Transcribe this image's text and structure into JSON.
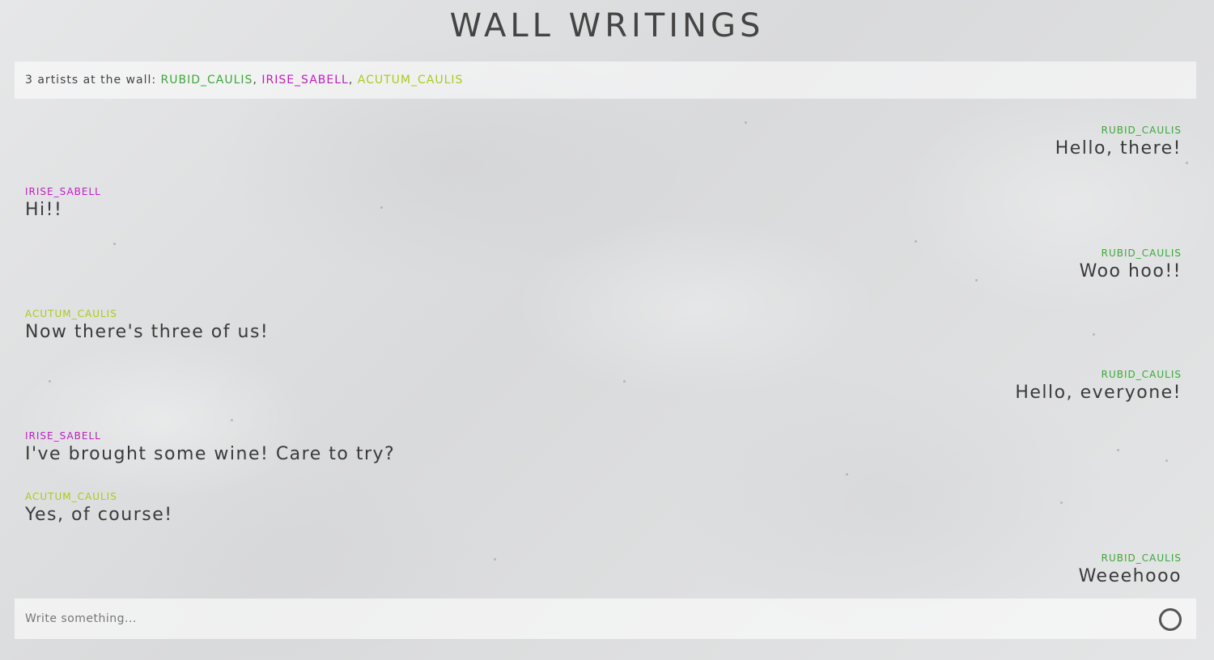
{
  "app": {
    "title": "WALL WRITINGS"
  },
  "artists": {
    "prefix": "3 artists at the wall:",
    "separator": ",",
    "names": [
      {
        "name": "RUBID_CAULIS",
        "color": "#3aa937"
      },
      {
        "name": "IRISE_SABELL",
        "color": "#c01dc2"
      },
      {
        "name": "ACUTUM_CAULIS",
        "color": "#a6cc1c"
      }
    ]
  },
  "messages": [
    {
      "author": "RUBID_CAULIS",
      "text": "Hello, there!",
      "side": "right"
    },
    {
      "author": "IRISE_SABELL",
      "text": "Hi!!",
      "side": "left"
    },
    {
      "author": "RUBID_CAULIS",
      "text": "Woo hoo!!",
      "side": "right"
    },
    {
      "author": "ACUTUM_CAULIS",
      "text": "Now there's three of us!",
      "side": "left"
    },
    {
      "author": "RUBID_CAULIS",
      "text": "Hello, everyone!",
      "side": "right"
    },
    {
      "author": "IRISE_SABELL",
      "text": "I've brought some wine! Care to try?",
      "side": "left"
    },
    {
      "author": "ACUTUM_CAULIS",
      "text": "Yes, of course!",
      "side": "left"
    },
    {
      "author": "RUBID_CAULIS",
      "text": "Weeehooo",
      "side": "right"
    }
  ],
  "composer": {
    "placeholder": "Write something...",
    "value": "",
    "send_icon": "circle-icon"
  }
}
